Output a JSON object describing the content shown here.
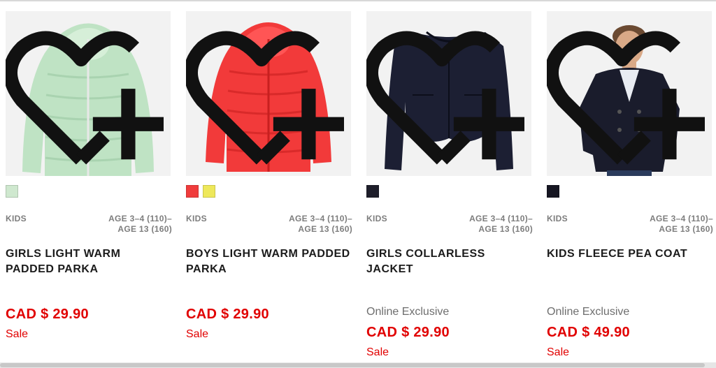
{
  "products": [
    {
      "category": "KIDS",
      "age_range": "AGE 3–4 (110)–\nAGE 13 (160)",
      "title": "GIRLS LIGHT WARM PADDED PARKA",
      "online_exclusive": "",
      "price": "CAD $ 29.90",
      "sale_label": "Sale",
      "swatches": [
        "#cfe8cf"
      ],
      "image_icon": "mint-puffer-jacket-image",
      "favorite_icon": "heart-plus-icon"
    },
    {
      "category": "KIDS",
      "age_range": "AGE 3–4 (110)–\nAGE 13 (160)",
      "title": "BOYS LIGHT WARM PADDED PARKA",
      "online_exclusive": "",
      "price": "CAD $ 29.90",
      "sale_label": "Sale",
      "swatches": [
        "#f03c3c",
        "#eee85a"
      ],
      "image_icon": "red-puffer-jacket-image",
      "favorite_icon": "heart-plus-icon"
    },
    {
      "category": "KIDS",
      "age_range": "AGE 3–4 (110)–\nAGE 13 (160)",
      "title": "GIRLS COLLARLESS JACKET",
      "online_exclusive": "Online Exclusive",
      "price": "CAD $ 29.90",
      "sale_label": "Sale",
      "swatches": [
        "#1e1e2a"
      ],
      "image_icon": "navy-collarless-jacket-image",
      "favorite_icon": "heart-plus-icon"
    },
    {
      "category": "KIDS",
      "age_range": "AGE 3–4 (110)–\nAGE 13 (160)",
      "title": "KIDS FLEECE PEA COAT",
      "online_exclusive": "Online Exclusive",
      "price": "CAD $ 49.90",
      "sale_label": "Sale",
      "swatches": [
        "#161622"
      ],
      "image_icon": "boy-pea-coat-photo",
      "favorite_icon": "heart-plus-icon"
    }
  ],
  "colors": {
    "price_red": "#e10000",
    "muted": "#7d7d7d"
  }
}
